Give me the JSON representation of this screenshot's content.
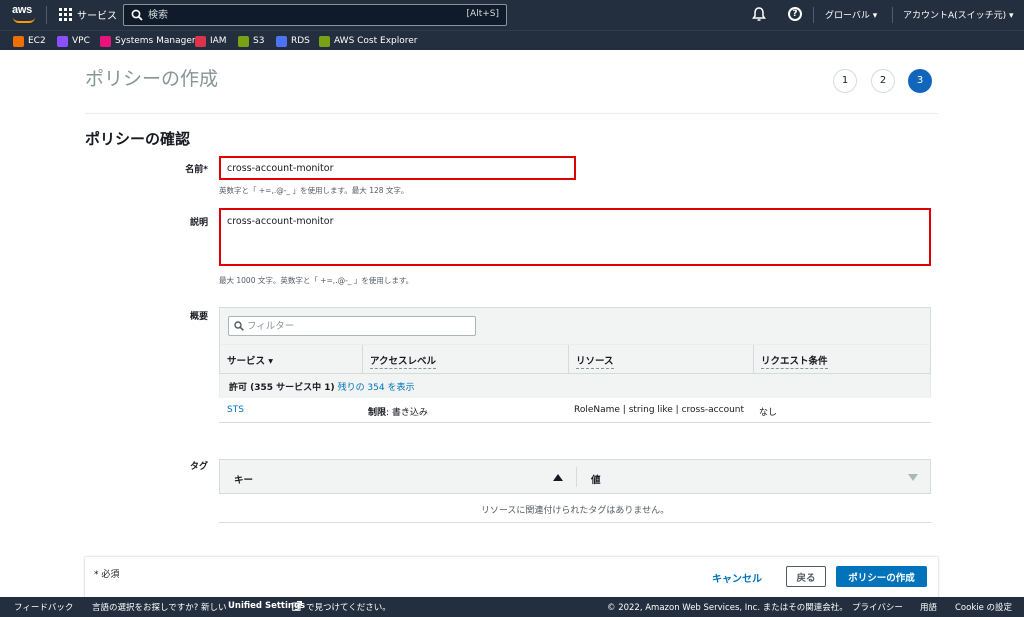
{
  "nav": {
    "services_label": "サービス",
    "search_placeholder": "検索",
    "search_shortcut": "[Alt+S]",
    "region": "グローバル ▾",
    "account": "アカウントA(スイッチ元) ▾"
  },
  "favorites": [
    {
      "label": "EC2",
      "color": "#ed7100"
    },
    {
      "label": "VPC",
      "color": "#8c4fff"
    },
    {
      "label": "Systems Manager",
      "color": "#e7157b"
    },
    {
      "label": "IAM",
      "color": "#dd344c"
    },
    {
      "label": "S3",
      "color": "#7aa116"
    },
    {
      "label": "RDS",
      "color": "#4d72f3"
    },
    {
      "label": "AWS Cost Explorer",
      "color": "#7aa116"
    }
  ],
  "page": {
    "title": "ポリシーの作成",
    "steps": [
      "1",
      "2",
      "3"
    ],
    "active_step": "3",
    "section_title": "ポリシーの確認"
  },
  "form": {
    "name_label": "名前*",
    "name_value": "cross-account-monitor",
    "name_hint": "英数字と「 +=,.@-_ 」を使用します。最大 128 文字。",
    "desc_label": "説明",
    "desc_value": "cross-account-monitor",
    "desc_hint": "最大 1000 文字。英数字と「 +=,.@-_ 」を使用します。"
  },
  "summary": {
    "label": "概要",
    "filter_placeholder": "フィルター",
    "columns": [
      "サービス ▾",
      "アクセスレベル",
      "リソース",
      "リクエスト条件"
    ],
    "group_text": "許可 (355 サービス中 1)",
    "group_link": "残りの 354 を表示",
    "row": {
      "service": "STS",
      "access_bold": "制限",
      "access_rest": ": 書き込み",
      "resource": "RoleName | string like | cross-account",
      "condition": "なし"
    }
  },
  "tags": {
    "label": "タグ",
    "key_header": "キー",
    "value_header": "値",
    "empty_text": "リソースに関連付けられたタグはありません。"
  },
  "actions": {
    "required_note": "* 必須",
    "cancel": "キャンセル",
    "back": "戻る",
    "create": "ポリシーの作成"
  },
  "footer": {
    "feedback": "フィードバック",
    "lang_prompt": "言語の選択をお探しですか? 新しい",
    "unified_settings": "Unified Settings",
    "lang_suffix": "で見つけてください。",
    "copyright": "© 2022, Amazon Web Services, Inc. またはその関連会社。",
    "privacy": "プライバシー",
    "terms": "用語",
    "cookie": "Cookie の設定"
  }
}
